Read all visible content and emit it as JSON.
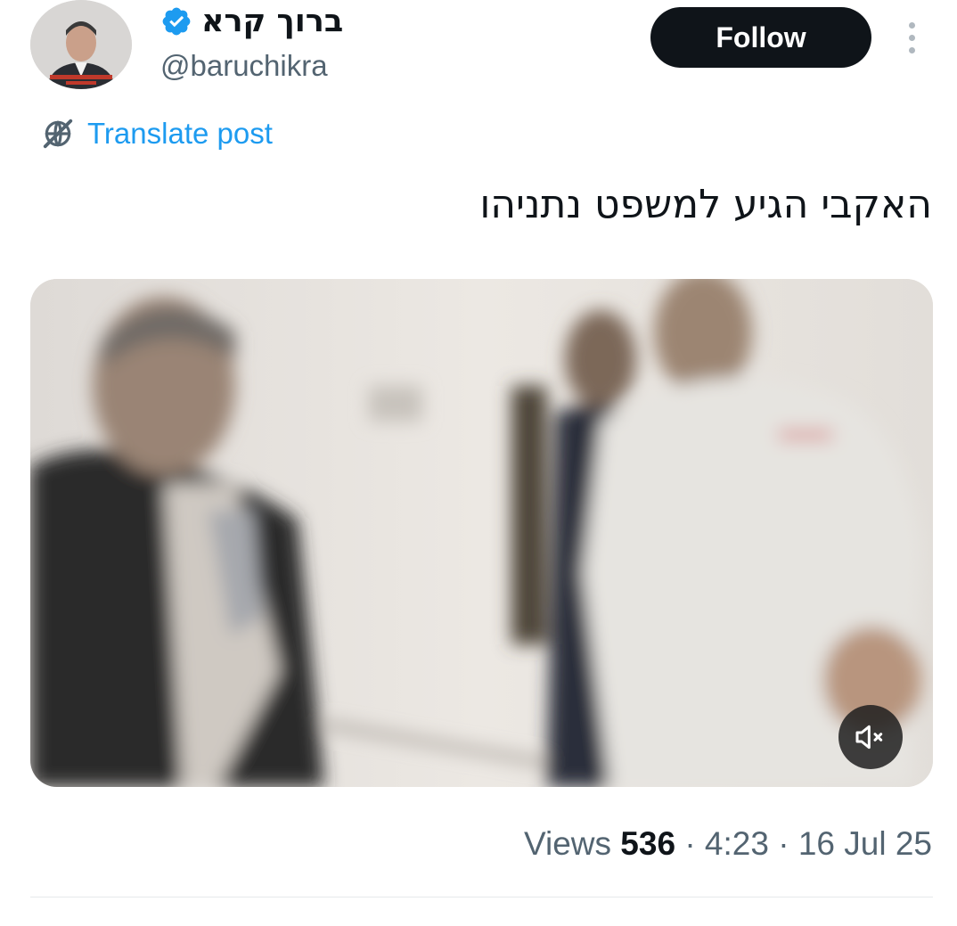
{
  "author": {
    "display_name": "ברוך קרא",
    "handle": "@baruchikra",
    "verified": true,
    "avatar_icon": "profile-photo"
  },
  "follow_button": {
    "label": "Follow"
  },
  "more_icon": "more-vertical-icon",
  "translate": {
    "label": "Translate post",
    "icon": "globe-slash-icon"
  },
  "post": {
    "text": "האקבי הגיע למשפט נתניהו"
  },
  "media": {
    "type": "video",
    "mute_icon": "volume-mute-icon"
  },
  "meta": {
    "views_label": "Views",
    "views_count": "536",
    "separator": "·",
    "time": "4:23",
    "date": "16 Jul 25"
  },
  "colors": {
    "accent": "#1d9bf0",
    "text_primary": "#0f1419",
    "text_secondary": "#536471",
    "button_bg": "#0f1419"
  }
}
